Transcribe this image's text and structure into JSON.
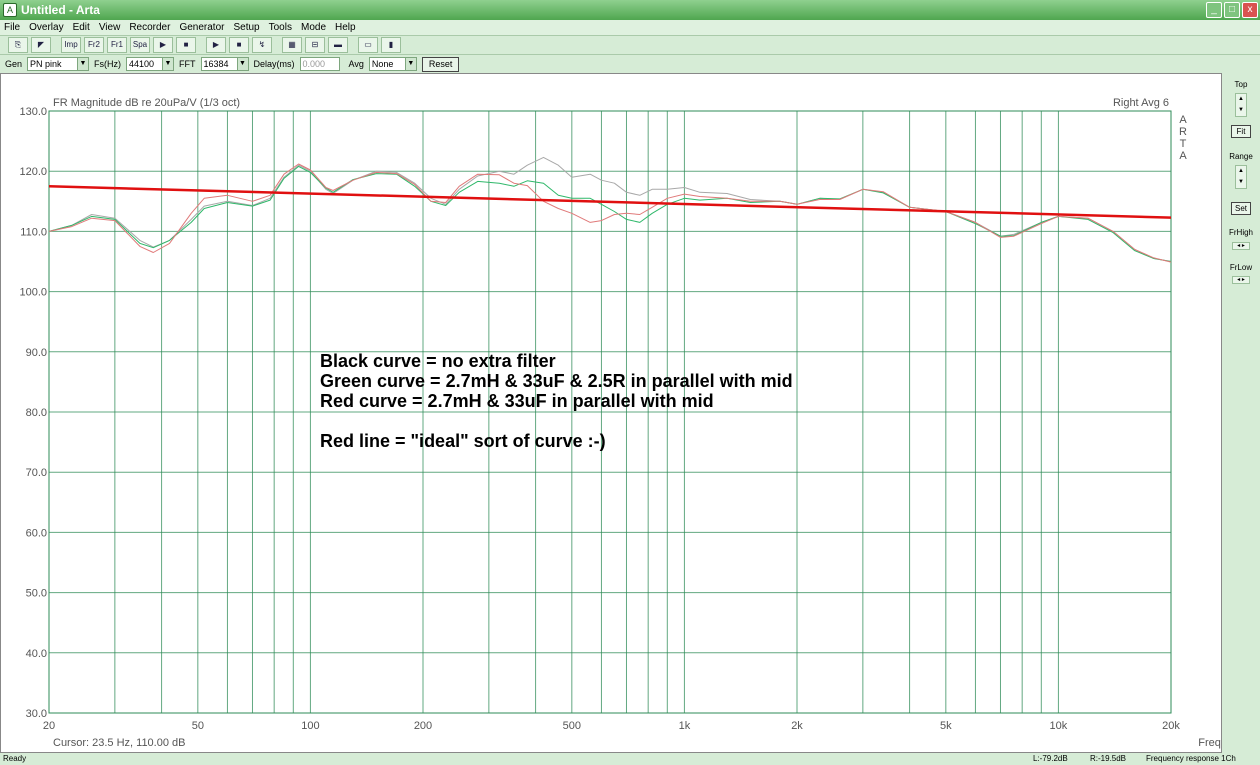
{
  "window": {
    "title": "Untitled - Arta",
    "min": "_",
    "max": "□",
    "close": "x"
  },
  "menu": [
    "File",
    "Overlay",
    "Edit",
    "View",
    "Recorder",
    "Generator",
    "Setup",
    "Tools",
    "Mode",
    "Help"
  ],
  "toolbar": {
    "buttons": [
      {
        "icon": "copy-icon",
        "glyph": "⎘"
      },
      {
        "icon": "cursor-icon",
        "glyph": "◤"
      },
      {
        "icon": "sep",
        "glyph": ""
      },
      {
        "icon": "impulse-icon",
        "glyph": "Imp"
      },
      {
        "icon": "fr2-icon",
        "glyph": "Fr2"
      },
      {
        "icon": "fr1-icon",
        "glyph": "Fr1"
      },
      {
        "icon": "spa-icon",
        "glyph": "Spa"
      },
      {
        "icon": "record-icon",
        "glyph": "▶"
      },
      {
        "icon": "stop-icon",
        "glyph": "■"
      },
      {
        "icon": "sep",
        "glyph": ""
      },
      {
        "icon": "play-icon",
        "glyph": "▶"
      },
      {
        "icon": "stop2-icon",
        "glyph": "■"
      },
      {
        "icon": "calib-icon",
        "glyph": "↯"
      },
      {
        "icon": "sep",
        "glyph": ""
      },
      {
        "icon": "grid-icon",
        "glyph": "▦"
      },
      {
        "icon": "meter-icon",
        "glyph": "⊟"
      },
      {
        "icon": "level-icon",
        "glyph": "▬"
      },
      {
        "icon": "sep",
        "glyph": ""
      },
      {
        "icon": "screen-icon",
        "glyph": "▭"
      },
      {
        "icon": "battery-icon",
        "glyph": "▮"
      }
    ]
  },
  "genbar": {
    "gen_label": "Gen",
    "gen_value": "PN pink",
    "fs_label": "Fs(Hz)",
    "fs_value": "44100",
    "fft_label": "FFT",
    "fft_value": "16384",
    "delay_label": "Delay(ms)",
    "delay_value": "0.000",
    "avg_label": "Avg",
    "avg_value": "None",
    "reset_label": "Reset"
  },
  "chart_data": {
    "type": "line",
    "title": "FR Magnitude dB re 20uPa/V (1/3 oct)",
    "top_right": "Right  Avg 6",
    "watermark": "ARTA",
    "xlabel": "Frequency(Hz)",
    "cursor": "Cursor:   23.5 Hz, 110.00 dB",
    "x_scale": "log",
    "xlim": [
      20,
      20000
    ],
    "ylim": [
      30,
      130
    ],
    "y_ticks": [
      "130.0",
      "120.0",
      "110.0",
      "100.0",
      "90.0",
      "80.0",
      "70.0",
      "60.0",
      "50.0",
      "40.0",
      "30.0"
    ],
    "x_ticks": [
      {
        "v": 20,
        "l": "20"
      },
      {
        "v": 50,
        "l": "50"
      },
      {
        "v": 100,
        "l": "100"
      },
      {
        "v": 200,
        "l": "200"
      },
      {
        "v": 500,
        "l": "500"
      },
      {
        "v": 1000,
        "l": "1k"
      },
      {
        "v": 2000,
        "l": "2k"
      },
      {
        "v": 5000,
        "l": "5k"
      },
      {
        "v": 10000,
        "l": "10k"
      },
      {
        "v": 20000,
        "l": "20k"
      }
    ],
    "colors": {
      "grid": "#2e8b57",
      "black": "#a8a8a8",
      "green": "#2fb86a",
      "red": "#e07a7a",
      "line": "#e01010",
      "axis_text": "#555555"
    },
    "series": [
      {
        "key": "black",
        "points": [
          [
            20,
            110
          ],
          [
            23,
            111
          ],
          [
            26,
            112.8
          ],
          [
            30,
            112.2
          ],
          [
            35,
            108.5
          ],
          [
            38,
            107.4
          ],
          [
            42,
            108.5
          ],
          [
            48,
            112
          ],
          [
            52,
            114.2
          ],
          [
            60,
            115
          ],
          [
            70,
            114.3
          ],
          [
            78,
            115.5
          ],
          [
            85,
            119
          ],
          [
            93,
            121
          ],
          [
            100,
            120
          ],
          [
            110,
            117
          ],
          [
            115,
            116.3
          ],
          [
            130,
            118.5
          ],
          [
            150,
            120
          ],
          [
            170,
            119.8
          ],
          [
            190,
            118
          ],
          [
            210,
            115.5
          ],
          [
            230,
            114.5
          ],
          [
            250,
            117
          ],
          [
            280,
            119.2
          ],
          [
            320,
            120
          ],
          [
            350,
            119.5
          ],
          [
            380,
            121
          ],
          [
            420,
            122.3
          ],
          [
            460,
            121
          ],
          [
            500,
            119
          ],
          [
            560,
            119.5
          ],
          [
            600,
            118.5
          ],
          [
            650,
            118
          ],
          [
            700,
            116.5
          ],
          [
            760,
            116
          ],
          [
            820,
            117
          ],
          [
            900,
            117
          ],
          [
            1000,
            117.3
          ],
          [
            1100,
            116.5
          ],
          [
            1300,
            116.3
          ],
          [
            1500,
            115.3
          ],
          [
            1800,
            115
          ],
          [
            2000,
            114.5
          ],
          [
            2300,
            115.5
          ],
          [
            2600,
            115.3
          ],
          [
            3000,
            117
          ],
          [
            3400,
            116.5
          ],
          [
            4000,
            114
          ],
          [
            5000,
            113.3
          ],
          [
            6000,
            111.5
          ],
          [
            7000,
            109.2
          ],
          [
            7600,
            109.5
          ],
          [
            9000,
            111.5
          ],
          [
            10000,
            112.5
          ],
          [
            12000,
            112.2
          ],
          [
            14000,
            110
          ],
          [
            16000,
            107
          ],
          [
            18000,
            105.5
          ],
          [
            20000,
            105
          ]
        ]
      },
      {
        "key": "green",
        "points": [
          [
            20,
            110
          ],
          [
            23,
            111
          ],
          [
            26,
            112.5
          ],
          [
            30,
            112
          ],
          [
            35,
            108
          ],
          [
            38,
            107.3
          ],
          [
            42,
            108.5
          ],
          [
            48,
            111.5
          ],
          [
            52,
            113.8
          ],
          [
            60,
            114.8
          ],
          [
            70,
            114.2
          ],
          [
            78,
            115.2
          ],
          [
            85,
            118.8
          ],
          [
            93,
            120.8
          ],
          [
            100,
            119.8
          ],
          [
            110,
            117.2
          ],
          [
            115,
            116.5
          ],
          [
            130,
            118.6
          ],
          [
            150,
            119.6
          ],
          [
            170,
            119.5
          ],
          [
            190,
            117.5
          ],
          [
            210,
            115
          ],
          [
            230,
            114.3
          ],
          [
            250,
            116.5
          ],
          [
            280,
            118.3
          ],
          [
            320,
            118
          ],
          [
            350,
            117.5
          ],
          [
            380,
            118.4
          ],
          [
            420,
            118
          ],
          [
            460,
            116
          ],
          [
            500,
            115.5
          ],
          [
            560,
            115.5
          ],
          [
            600,
            114.5
          ],
          [
            650,
            113.3
          ],
          [
            700,
            112
          ],
          [
            760,
            111.5
          ],
          [
            820,
            113
          ],
          [
            900,
            114.5
          ],
          [
            1000,
            115.5
          ],
          [
            1100,
            115.2
          ],
          [
            1300,
            115.5
          ],
          [
            1500,
            114.8
          ],
          [
            1800,
            115
          ],
          [
            2000,
            114.5
          ],
          [
            2300,
            115.5
          ],
          [
            2600,
            115.4
          ],
          [
            3000,
            117
          ],
          [
            3400,
            116.4
          ],
          [
            4000,
            114
          ],
          [
            5000,
            113.3
          ],
          [
            6000,
            111.3
          ],
          [
            7000,
            109.2
          ],
          [
            7600,
            109.3
          ],
          [
            9000,
            111.5
          ],
          [
            10000,
            112.5
          ],
          [
            12000,
            112
          ],
          [
            14000,
            109.8
          ],
          [
            16000,
            106.8
          ],
          [
            18000,
            105.5
          ],
          [
            20000,
            105
          ]
        ]
      },
      {
        "key": "red",
        "points": [
          [
            20,
            110
          ],
          [
            23,
            110.8
          ],
          [
            26,
            112.2
          ],
          [
            30,
            111.8
          ],
          [
            35,
            107.5
          ],
          [
            38,
            106.5
          ],
          [
            42,
            108
          ],
          [
            48,
            113
          ],
          [
            52,
            115.5
          ],
          [
            60,
            116
          ],
          [
            70,
            115
          ],
          [
            78,
            116
          ],
          [
            85,
            119.5
          ],
          [
            93,
            121.2
          ],
          [
            100,
            120.2
          ],
          [
            110,
            117.3
          ],
          [
            115,
            116.8
          ],
          [
            130,
            118.5
          ],
          [
            150,
            119.8
          ],
          [
            170,
            119.6
          ],
          [
            190,
            117.8
          ],
          [
            210,
            115
          ],
          [
            230,
            114.8
          ],
          [
            250,
            117.5
          ],
          [
            280,
            119.5
          ],
          [
            320,
            119.4
          ],
          [
            350,
            118
          ],
          [
            380,
            117.6
          ],
          [
            420,
            115
          ],
          [
            460,
            113.8
          ],
          [
            500,
            113
          ],
          [
            560,
            111.5
          ],
          [
            600,
            111.8
          ],
          [
            650,
            112.8
          ],
          [
            700,
            113
          ],
          [
            760,
            112.8
          ],
          [
            820,
            114
          ],
          [
            900,
            115.5
          ],
          [
            1000,
            116.2
          ],
          [
            1100,
            115.8
          ],
          [
            1300,
            115.5
          ],
          [
            1500,
            115
          ],
          [
            1800,
            115
          ],
          [
            2000,
            114.5
          ],
          [
            2300,
            115.3
          ],
          [
            2600,
            115.3
          ],
          [
            3000,
            117
          ],
          [
            3400,
            116.6
          ],
          [
            4000,
            114
          ],
          [
            5000,
            113.3
          ],
          [
            6000,
            111.5
          ],
          [
            7000,
            109
          ],
          [
            7600,
            109.2
          ],
          [
            9000,
            111.3
          ],
          [
            10000,
            112.5
          ],
          [
            12000,
            112.2
          ],
          [
            14000,
            110
          ],
          [
            16000,
            107
          ],
          [
            18000,
            105.6
          ],
          [
            20000,
            104.9
          ]
        ]
      },
      {
        "key": "line",
        "points": [
          [
            20,
            117.5
          ],
          [
            20000,
            112.3
          ]
        ]
      }
    ]
  },
  "annotations": [
    "Black curve = no extra filter",
    "Green curve = 2.7mH & 33uF & 2.5R in parallel with mid",
    "Red curve = 2.7mH & 33uF in parallel with mid",
    "",
    "Red line = \"ideal\" sort of curve :-)"
  ],
  "rightpanel": {
    "top_label": "Top",
    "fit_label": "Fit",
    "range_label": "Range",
    "set_label": "Set",
    "frhigh_label": "FrHigh",
    "frlow_label": "FrLow"
  },
  "status": {
    "left": "Ready",
    "l_level": "L:-79.2dB",
    "r_level": "R:-19.5dB",
    "mode": "Frequency response 1Ch"
  }
}
